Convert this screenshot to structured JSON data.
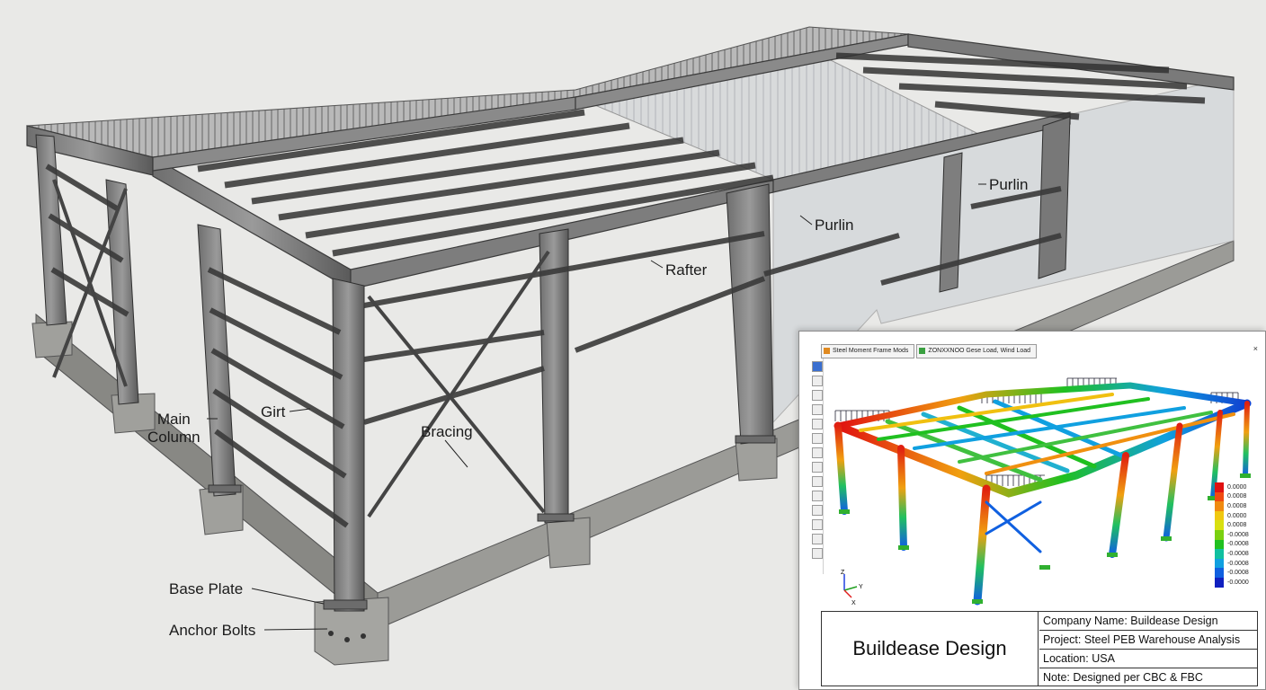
{
  "callouts": {
    "purlin_right": "Purlin",
    "purlin_mid": "Purlin",
    "rafter": "Rafter",
    "main_column": "Main\nColumn",
    "girt": "Girt",
    "bracing": "Bracing",
    "base_plate": "Base Plate",
    "anchor_bolts": "Anchor Bolts"
  },
  "analysis_window": {
    "tabs": [
      {
        "label": "Steel Moment Frame Mods"
      },
      {
        "label": "ZONXXNOO Gese Load, Wind Load"
      }
    ],
    "close_label": "×",
    "axis_labels": {
      "z": "Z",
      "y": "Y",
      "x": "X"
    },
    "legend_values": [
      "0.0000",
      "0.0008",
      "0.0008",
      "0.0000",
      "0.0008",
      "-0.0008",
      "-0.0008",
      "-0.0008",
      "-0.0008",
      "-0.0008",
      "-0.0000"
    ],
    "legend_colors": [
      "#e01010",
      "#f04a10",
      "#f08a10",
      "#f0c810",
      "#d8e010",
      "#7ad010",
      "#20c020",
      "#10c0a0",
      "#10a0e0",
      "#1060e0",
      "#1020c0"
    ]
  },
  "title_block": {
    "company_display": "Buildease Design",
    "company_name": "Company Name: Buildease Design",
    "project": "Project: Steel PEB Warehouse Analysis",
    "location": "Location: USA",
    "note": "Note: Designed per CBC & FBC"
  }
}
